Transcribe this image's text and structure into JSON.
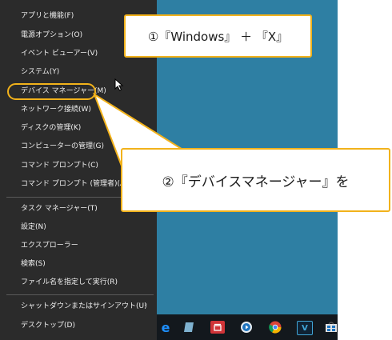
{
  "menu": {
    "items": [
      {
        "label": "アプリと機能(F)"
      },
      {
        "label": "電源オプション(O)"
      },
      {
        "label": "イベント ビューアー(V)"
      },
      {
        "label": "システム(Y)"
      },
      {
        "label": "デバイス マネージャー(M)"
      },
      {
        "label": "ネットワーク接続(W)"
      },
      {
        "label": "ディスクの管理(K)"
      },
      {
        "label": "コンピューターの管理(G)"
      },
      {
        "label": "コマンド プロンプト(C)"
      },
      {
        "label": "コマンド プロンプト (管理者)(A)"
      },
      {
        "label": "タスク マネージャー(T)"
      },
      {
        "label": "設定(N)"
      },
      {
        "label": "エクスプローラー"
      },
      {
        "label": "検索(S)"
      },
      {
        "label": "ファイル名を指定して実行(R)"
      },
      {
        "label": "シャットダウンまたはサインアウト(U)"
      },
      {
        "label": "デスクトップ(D)"
      }
    ],
    "submenu_arrow": "›"
  },
  "callouts": {
    "step1": "①『Windows』 ＋ 『X』",
    "step2": "②『デバイスマネージャー』を"
  },
  "taskbar": {
    "icons": [
      "edge-icon",
      "photos-icon",
      "calendar-icon",
      "media-player-icon",
      "chrome-icon",
      "v-app-icon",
      "store-icon"
    ],
    "v_app_letter": "V"
  },
  "colors": {
    "menu_bg": "#2b2b2b",
    "desktop_bg": "#2e7fa3",
    "accent_callout": "#f2b21b",
    "taskbar_bg": "#13181d"
  }
}
